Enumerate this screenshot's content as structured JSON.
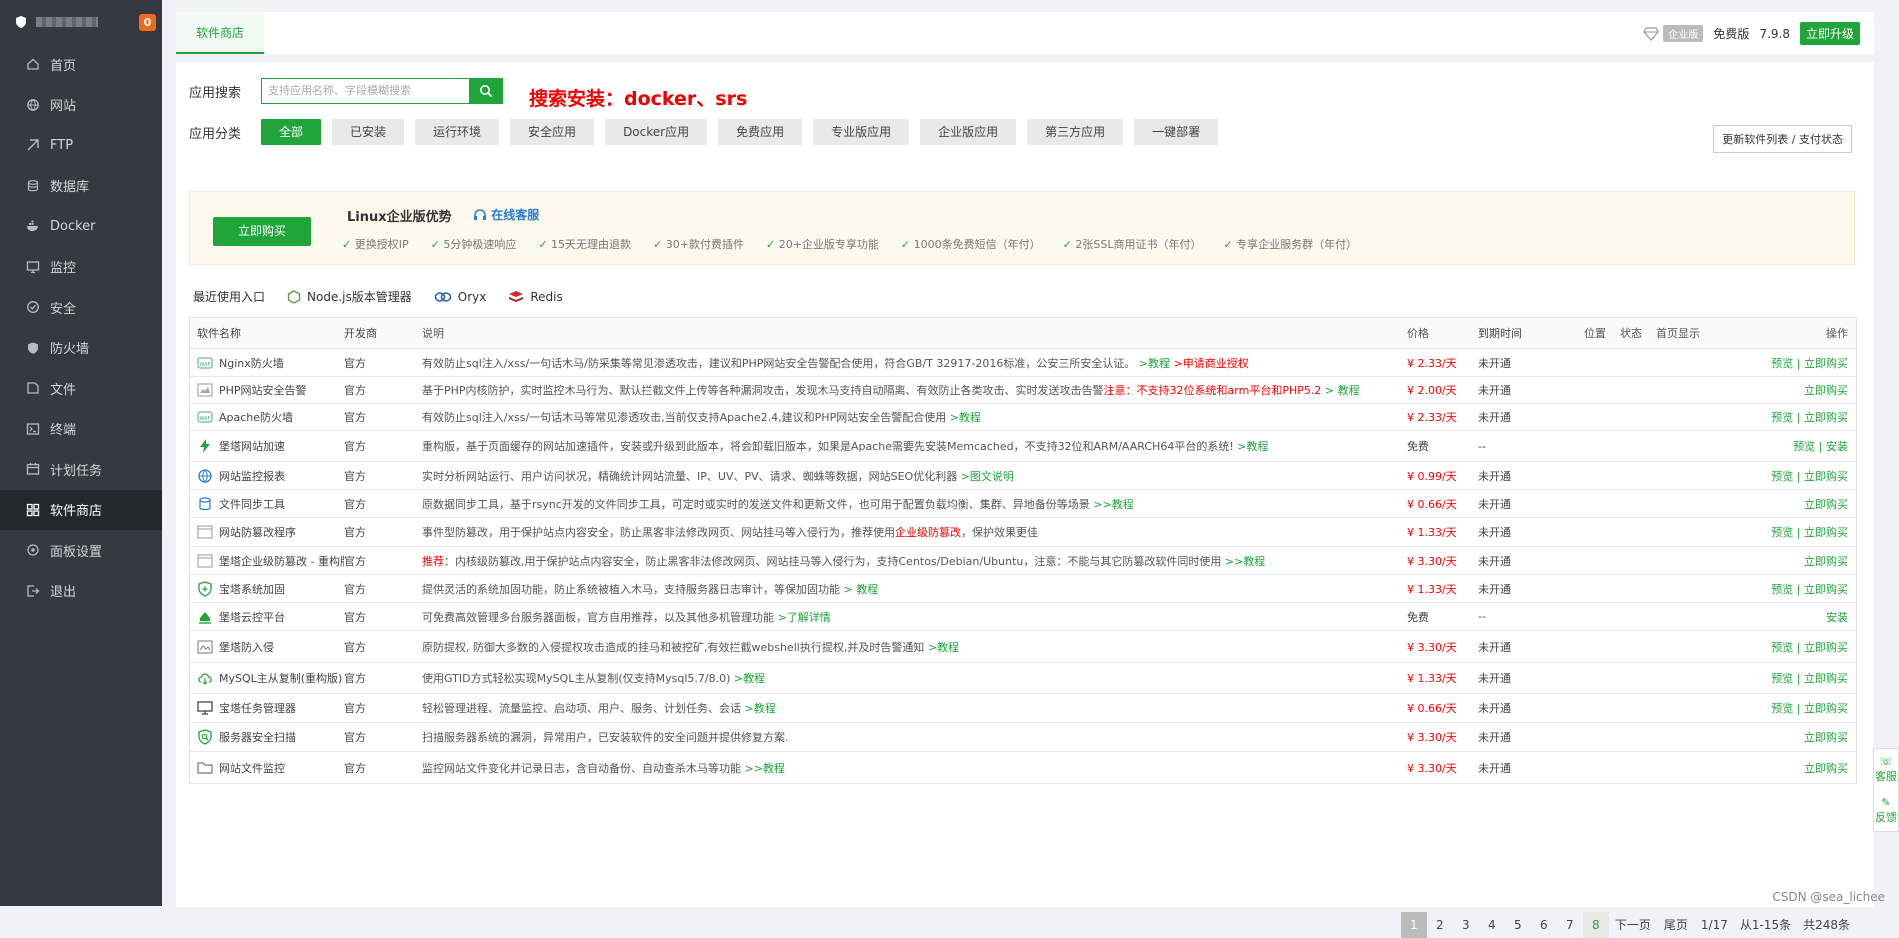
{
  "sidebar": {
    "badge": "0",
    "items": [
      {
        "label": "首页",
        "icon": "home-icon"
      },
      {
        "label": "网站",
        "icon": "globe-icon"
      },
      {
        "label": "FTP",
        "icon": "ftp-icon"
      },
      {
        "label": "数据库",
        "icon": "database-icon"
      },
      {
        "label": "Docker",
        "icon": "docker-icon"
      },
      {
        "label": "监控",
        "icon": "monitor-icon"
      },
      {
        "label": "安全",
        "icon": "shield-check-icon"
      },
      {
        "label": "防火墙",
        "icon": "firewall-icon"
      },
      {
        "label": "文件",
        "icon": "folder-icon"
      },
      {
        "label": "终端",
        "icon": "terminal-icon"
      },
      {
        "label": "计划任务",
        "icon": "calendar-icon"
      },
      {
        "label": "软件商店",
        "icon": "grid-icon",
        "active": true
      },
      {
        "label": "面板设置",
        "icon": "gear-icon"
      },
      {
        "label": "退出",
        "icon": "logout-icon"
      }
    ]
  },
  "topbar": {
    "tab": "软件商店",
    "edition_tag": "企业版",
    "free_label": "免费版",
    "version": "7.9.8",
    "upgrade": "立即升级"
  },
  "search": {
    "label": "应用搜索",
    "placeholder": "支持应用名称、字段模糊搜索",
    "note": "搜索安装：docker、srs"
  },
  "categories": {
    "label": "应用分类",
    "items": [
      "全部",
      "已安装",
      "运行环境",
      "安全应用",
      "Docker应用",
      "免费应用",
      "专业版应用",
      "企业版应用",
      "第三方应用",
      "一键部署"
    ],
    "refresh": "更新软件列表 / 支付状态"
  },
  "promo": {
    "buy": "立即购买",
    "title": "Linux企业版优势",
    "service": "在线客服",
    "features": [
      "更换授权IP",
      "5分钟极速响应",
      "15天无理由退款",
      "30+款付费插件",
      "20+企业版专享功能",
      "1000条免费短信（年付）",
      "2张SSL商用证书（年付）",
      "专享企业服务群（年付）"
    ]
  },
  "recent": {
    "label": "最近使用入口",
    "items": [
      "Node.js版本管理器",
      "Oryx",
      "Redis"
    ]
  },
  "table": {
    "headers": [
      "软件名称",
      "开发商",
      "说明",
      "价格",
      "到期时间",
      "位置",
      "状态",
      "首页显示",
      "操作"
    ],
    "rows": [
      {
        "name": "Nginx防火墙",
        "dev": "官方",
        "desc": "有效防止sql注入/xss/一句话木马/防采集等常见渗透攻击，建议和PHP网站安全告警配合使用，符合GB/T 32917-2016标准，公安三所安全认证。",
        "link": ">教程",
        "link2": ">申请商业授权",
        "price": "¥ 2.33/天",
        "exp": "未开通",
        "op": "预览 | 立即购买"
      },
      {
        "name": "PHP网站安全告警",
        "dev": "官方",
        "desc": "基于PHP内核防护，实时监控木马行为、默认拦截文件上传等各种漏洞攻击，发现木马支持自动隔离、有效防止各类攻击、实时发送攻击告警",
        "warn": "注意：不支持32位系统和arm平台和PHP5.2",
        "link": "> 教程",
        "price": "¥ 2.00/天",
        "exp": "未开通",
        "op": "立即购买"
      },
      {
        "name": "Apache防火墙",
        "dev": "官方",
        "desc": "有效防止sql注入/xss/一句话木马等常见渗透攻击,当前仅支持Apache2.4,建议和PHP网站安全告警配合使用",
        "link": ">教程",
        "price": "¥ 2.33/天",
        "exp": "未开通",
        "op": "预览 | 立即购买"
      },
      {
        "name": "堡塔网站加速",
        "dev": "官方",
        "desc": "重构版，基于页面缓存的网站加速插件，安装或升级到此版本，将会卸载旧版本，如果是Apache需要先安装Memcached，不支持32位和ARM/AARCH64平台的系统!",
        "link": ">教程",
        "price": "免费",
        "exp": "--",
        "op": "预览 | 安装"
      },
      {
        "name": "网站监控报表",
        "dev": "官方",
        "desc": "实时分析网站运行、用户访问状况，精确统计网站流量、IP、UV、PV、请求、蜘蛛等数据，网站SEO优化利器",
        "link": ">图文说明",
        "price": "¥ 0.99/天",
        "exp": "未开通",
        "op": "预览 | 立即购买"
      },
      {
        "name": "文件同步工具",
        "dev": "官方",
        "desc": "原数据同步工具，基于rsync开发的文件同步工具，可定时或实时的发送文件和更新文件，也可用于配置负载均衡、集群、异地备份等场景",
        "link": ">>教程",
        "price": "¥ 0.66/天",
        "exp": "未开通",
        "op": "立即购买"
      },
      {
        "name": "网站防篡改程序",
        "dev": "官方",
        "desc": "事件型防篡改，用于保护站点内容安全，防止黑客非法修改网页、网站挂马等入侵行为，推荐使用",
        "warn": "企业级防篡改",
        "desc2": "，保护效果更佳",
        "price": "¥ 1.33/天",
        "exp": "未开通",
        "op": "预览 | 立即购买"
      },
      {
        "name": "堡塔企业级防篡改 - 重构版",
        "dev": "官方",
        "pre": "推荐",
        "desc": "：内核级防篡改,用于保护站点内容安全，防止黑客非法修改网页、网站挂马等入侵行为，支持Centos/Debian/Ubuntu，注意：不能与其它防篡改软件同时使用",
        "link": ">>教程",
        "price": "¥ 3.30/天",
        "exp": "未开通",
        "op": "立即购买"
      },
      {
        "name": "宝塔系统加固",
        "dev": "官方",
        "desc": "提供灵活的系统加固功能，防止系统被植入木马，支持服务器日志审计，等保加固功能",
        "link": "> 教程",
        "price": "¥ 1.33/天",
        "exp": "未开通",
        "op": "预览 | 立即购买"
      },
      {
        "name": "堡塔云控平台",
        "dev": "官方",
        "desc": "可免费高效管理多台服务器面板，官方自用推荐，以及其他多机管理功能",
        "link": ">了解详情",
        "price": "免费",
        "exp": "--",
        "op": "安装"
      },
      {
        "name": "堡塔防入侵",
        "dev": "官方",
        "desc": "原防提权, 防御大多数的入侵提权攻击造成的挂马和被挖矿,有效拦截webshell执行提权,并及时告警通知",
        "link": ">教程",
        "price": "¥ 3.30/天",
        "exp": "未开通",
        "op": "预览 | 立即购买"
      },
      {
        "name": "MySQL主从复制(重构版)",
        "dev": "官方",
        "desc": "使用GTID方式轻松实现MySQL主从复制(仅支持Mysql5.7/8.0)",
        "link": ">教程",
        "price": "¥ 1.33/天",
        "exp": "未开通",
        "op": "预览 | 立即购买"
      },
      {
        "name": "宝塔任务管理器",
        "dev": "官方",
        "desc": "轻松管理进程、流量监控、启动项、用户、服务、计划任务、会话",
        "link": ">教程",
        "price": "¥ 0.66/天",
        "exp": "未开通",
        "op": "预览 | 立即购买"
      },
      {
        "name": "服务器安全扫描",
        "dev": "官方",
        "desc": "扫描服务器系统的漏洞，异常用户，已安装软件的安全问题并提供修复方案.",
        "price": "¥ 3.30/天",
        "exp": "未开通",
        "op": "立即购买"
      },
      {
        "name": "网站文件监控",
        "dev": "官方",
        "desc": "监控网站文件变化并记录日志，含自动备份、自动查杀木马等功能",
        "link": ">>教程",
        "price": "¥ 3.30/天",
        "exp": "未开通",
        "op": "立即购买"
      }
    ]
  },
  "pager": {
    "pages": [
      "1",
      "2",
      "3",
      "4",
      "5",
      "6",
      "7",
      "8"
    ],
    "next": "下一页",
    "last": "尾页",
    "count": "1/17",
    "range": "从1-15条",
    "total": "共248条"
  },
  "float": {
    "service": "客服",
    "feedback": "反馈"
  },
  "watermark": "CSDN @sea_lichee"
}
